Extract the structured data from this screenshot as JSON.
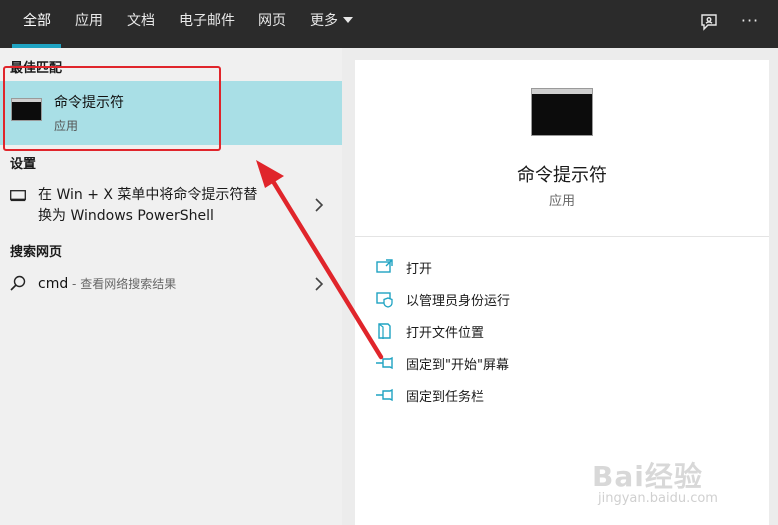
{
  "tabs": [
    {
      "label": "全部",
      "active": true
    },
    {
      "label": "应用"
    },
    {
      "label": "文档"
    },
    {
      "label": "电子邮件"
    },
    {
      "label": "网页"
    },
    {
      "label": "更多"
    }
  ],
  "top_icons": {
    "feedback": "feedback-icon",
    "more": "···"
  },
  "left": {
    "best_match_header": "最佳匹配",
    "best_match": {
      "title": "命令提示符",
      "subtitle": "应用",
      "icon": "cmd-icon"
    },
    "settings_header": "设置",
    "settings_item": {
      "line1": "在 Win + X 菜单中将命令提示符替",
      "line2": "换为 Windows PowerShell",
      "icon": "monitor-icon"
    },
    "web_header": "搜索网页",
    "web_item": {
      "query": "cmd",
      "suffix": " - 查看网络搜索结果",
      "icon": "search-icon"
    }
  },
  "preview": {
    "title": "命令提示符",
    "subtitle": "应用",
    "actions": [
      {
        "label": "打开",
        "icon": "open-icon"
      },
      {
        "label": "以管理员身份运行",
        "icon": "admin-shield-icon"
      },
      {
        "label": "打开文件位置",
        "icon": "file-location-icon"
      },
      {
        "label": "固定到\"开始\"屏幕",
        "icon": "pin-icon"
      },
      {
        "label": "固定到任务栏",
        "icon": "pin-icon"
      }
    ]
  },
  "colors": {
    "accent": "#1fa3c2",
    "highlight": "#a9dfe6",
    "annotation": "#e0252b",
    "topbar": "#2b2b2b"
  },
  "watermark": {
    "brand": "Bai经验",
    "url": "jingyan.baidu.com"
  }
}
